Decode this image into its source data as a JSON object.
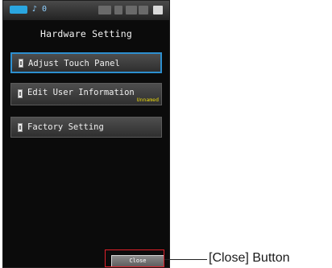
{
  "statusbar": {
    "mode_text": "♪ 0"
  },
  "screen": {
    "title": "Hardware Setting",
    "menu": [
      {
        "label": "Adjust Touch Panel",
        "sublabel": "",
        "selected": true
      },
      {
        "label": "Edit User Information",
        "sublabel": "Unnamed",
        "selected": false
      },
      {
        "label": "Factory Setting",
        "sublabel": "",
        "selected": false
      }
    ],
    "close_label": "Close"
  },
  "annotation": {
    "callout_text": "[Close] Button"
  },
  "colors": {
    "selected_border": "#2d8fcf",
    "highlight": "#e0202a",
    "sublabel": "#e8d60c"
  }
}
